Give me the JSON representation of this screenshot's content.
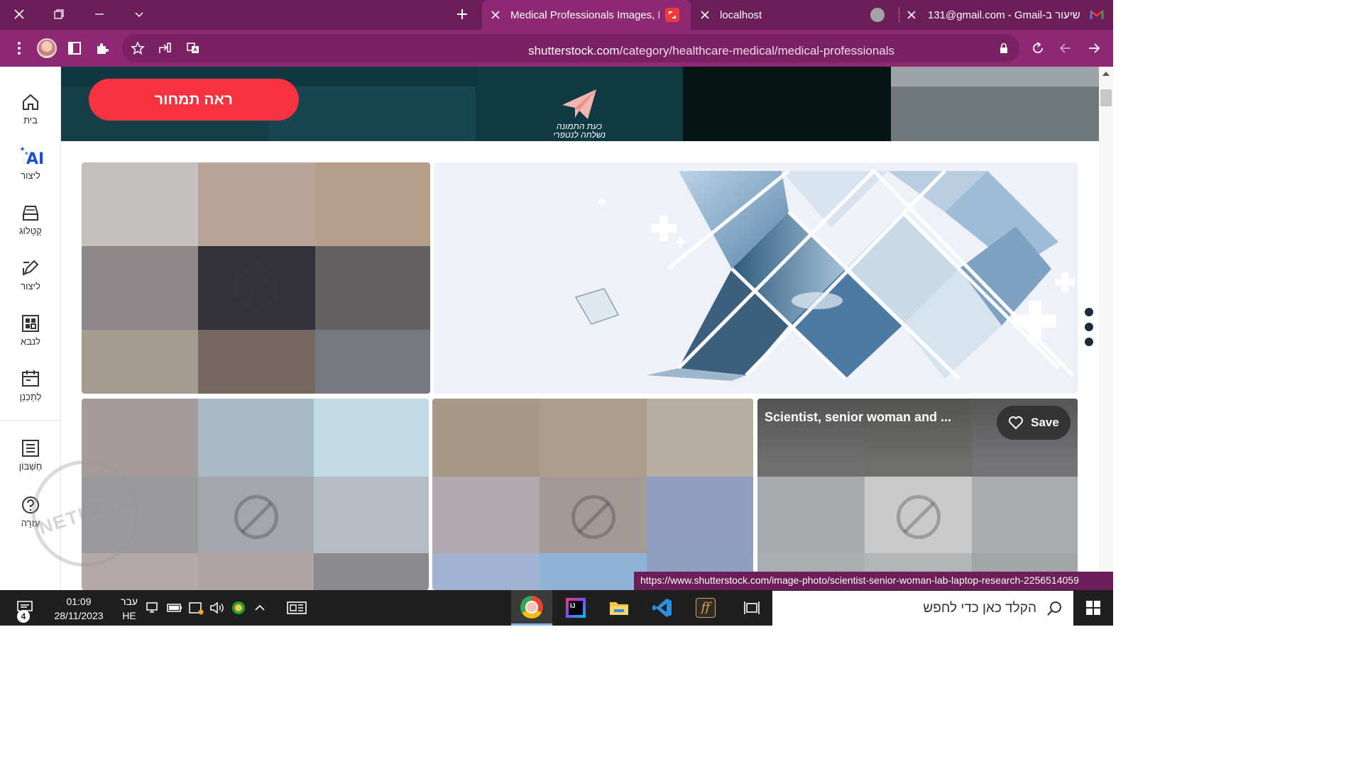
{
  "browser": {
    "tabs": [
      {
        "title": "Medical Professionals Images, Pi",
        "active": true
      },
      {
        "title": "localhost",
        "active": false
      },
      {
        "title": "131@gmail.com - Gmail-שיעור ב",
        "active": false
      }
    ],
    "url_domain": "shutterstock.com",
    "url_path": "/category/healthcare-medical/medical-professionals",
    "status_url": "https://www.shutterstock.com/image-photo/scientist-senior-woman-lab-laptop-research-2256514059"
  },
  "sidebar": {
    "items": [
      {
        "label": "בית",
        "icon": "home-icon"
      },
      {
        "label": "ליצור",
        "icon": "ai-sparkle-icon",
        "badge": "AI"
      },
      {
        "label": "קָטָלוֹג",
        "icon": "catalog-icon"
      },
      {
        "label": "ליצור",
        "icon": "edit-icon"
      },
      {
        "label": "לנבא",
        "icon": "predict-icon"
      },
      {
        "label": "לְתַכְנֵן",
        "icon": "calendar-icon"
      },
      {
        "label": "חֶשְׁבּוֹן",
        "icon": "account-icon"
      },
      {
        "label": "עֶזרָה",
        "icon": "help-icon"
      }
    ]
  },
  "banner": {
    "cta_label": "ראה תמחור",
    "plane_caption_line1": "כעת התמונה",
    "plane_caption_line2": "נשלחה לנטפרי"
  },
  "cards": {
    "hovered_title": "Scientist, senior woman and ...",
    "save_label": "Save"
  },
  "watermark": {
    "text": "NETFREE"
  },
  "taskbar": {
    "time": "01:09",
    "date": "28/11/2023",
    "lang_line1": "עבר",
    "lang_line2": "HE",
    "notification_count": "4",
    "search_placeholder": "הקלד כאן כדי לחפש"
  },
  "colors": {
    "tab_bar": "#6b1e57",
    "toolbar": "#8e2872",
    "cta": "#f9323f",
    "banner": "#123f48"
  }
}
